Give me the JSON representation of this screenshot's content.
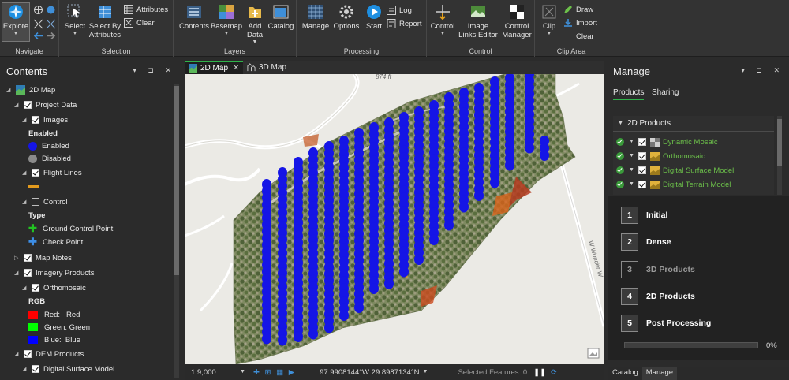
{
  "ribbon": {
    "groups": {
      "navigate": "Navigate",
      "selection": "Selection",
      "layers": "Layers",
      "processing": "Processing",
      "control": "Control",
      "clip_area": "Clip Area"
    },
    "explore": "Explore",
    "select": "Select",
    "select_by_attributes_1": "Select By",
    "select_by_attributes_2": "Attributes",
    "attributes": "Attributes",
    "clear_selection": "Clear",
    "contents": "Contents",
    "basemap": "Basemap",
    "add_data_1": "Add",
    "add_data_2": "Data",
    "catalog": "Catalog",
    "manage": "Manage",
    "options": "Options",
    "start": "Start",
    "log": "Log",
    "report": "Report",
    "control": "Control",
    "image_links_1": "Image",
    "image_links_2": "Links Editor",
    "control_manager_1": "Control",
    "control_manager_2": "Manager",
    "clip": "Clip",
    "draw": "Draw",
    "import": "Import",
    "clear_clip": "Clear"
  },
  "contents": {
    "title": "Contents",
    "tree": {
      "map2d": "2D Map",
      "project_data": "Project Data",
      "images": "Images",
      "enabled_heading": "Enabled",
      "enabled": "Enabled",
      "disabled": "Disabled",
      "flight_lines": "Flight Lines",
      "control": "Control",
      "type_heading": "Type",
      "gcp": "Ground Control Point",
      "check_point": "Check Point",
      "map_notes": "Map Notes",
      "imagery_products": "Imagery Products",
      "orthomosaic": "Orthomosaic",
      "rgb": "RGB",
      "red": "Red:   Red",
      "green": "Green: Green",
      "blue": "Blue:  Blue",
      "dem_products": "DEM Products",
      "dsm": "Digital Surface Model"
    }
  },
  "map": {
    "tab_2d": "2D Map",
    "tab_3d": "3D Map",
    "elevation_label": "874 ft",
    "road_label": "W Wonder W",
    "scale": "1:9,000",
    "coordinates": "97.9908144°W 29.8987134°N",
    "selected_features": "Selected Features: 0"
  },
  "manage": {
    "title": "Manage",
    "tab_products": "Products",
    "tab_sharing": "Sharing",
    "products_heading": "2D Products",
    "products": [
      {
        "label": "Dynamic Mosaic"
      },
      {
        "label": "Orthomosaic"
      },
      {
        "label": "Digital Surface Model"
      },
      {
        "label": "Digital Terrain Model"
      }
    ],
    "steps": [
      {
        "num": "1",
        "label": "Initial"
      },
      {
        "num": "2",
        "label": "Dense"
      },
      {
        "num": "3",
        "label": "3D Products"
      },
      {
        "num": "4",
        "label": "2D Products"
      },
      {
        "num": "5",
        "label": "Post Processing"
      }
    ],
    "progress_pct": "0%",
    "progress": 0,
    "bottom_tab_catalog": "Catalog",
    "bottom_tab_manage": "Manage"
  },
  "colors": {
    "accent_green": "#2fb34a",
    "enabled_blue": "#1515e6",
    "disabled_gray": "#8a8a8a",
    "flight_line_orange": "#e39a1d",
    "gcp_green": "#22c322",
    "check_point_blue": "#3d8ee6",
    "rgb_red": "#ff0000",
    "rgb_green": "#00ff00",
    "rgb_blue": "#0000ff"
  }
}
